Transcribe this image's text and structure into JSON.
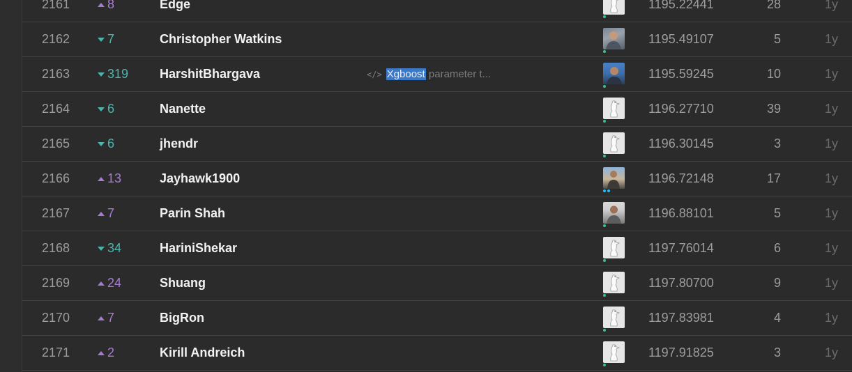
{
  "colors": {
    "background": "#2b2b2b",
    "rank_up": "#a77bd1",
    "rank_down": "#4db6ac",
    "highlight": "#3b78c8",
    "row_divider": "#444444"
  },
  "rows": [
    {
      "rank": "2161",
      "delta_dir": "up",
      "delta": "8",
      "team": "Edge",
      "kernel": null,
      "avatar": "goose",
      "score": "1195.22441",
      "entries": "28",
      "last": "1y"
    },
    {
      "rank": "2162",
      "delta_dir": "down",
      "delta": "7",
      "team": "Christopher Watkins",
      "kernel": null,
      "avatar": "photo",
      "score": "1195.49107",
      "entries": "5",
      "last": "1y"
    },
    {
      "rank": "2163",
      "delta_dir": "down",
      "delta": "319",
      "team": "HarshitBhargava",
      "kernel": {
        "icon": "code-icon",
        "highlight": "Xgboost",
        "rest": " parameter t..."
      },
      "avatar": "photo",
      "score": "1195.59245",
      "entries": "10",
      "last": "1y"
    },
    {
      "rank": "2164",
      "delta_dir": "down",
      "delta": "6",
      "team": "Nanette",
      "kernel": null,
      "avatar": "goose",
      "score": "1196.27710",
      "entries": "39",
      "last": "1y"
    },
    {
      "rank": "2165",
      "delta_dir": "down",
      "delta": "6",
      "team": "jhendr",
      "kernel": null,
      "avatar": "goose",
      "score": "1196.30145",
      "entries": "3",
      "last": "1y"
    },
    {
      "rank": "2166",
      "delta_dir": "up",
      "delta": "13",
      "team": "Jayhawk1900",
      "kernel": null,
      "avatar": "photo",
      "score": "1196.72148",
      "entries": "17",
      "last": "1y"
    },
    {
      "rank": "2167",
      "delta_dir": "up",
      "delta": "7",
      "team": "Parin Shah",
      "kernel": null,
      "avatar": "photo",
      "score": "1196.88101",
      "entries": "5",
      "last": "1y"
    },
    {
      "rank": "2168",
      "delta_dir": "down",
      "delta": "34",
      "team": "HariniShekar",
      "kernel": null,
      "avatar": "goose",
      "score": "1197.76014",
      "entries": "6",
      "last": "1y"
    },
    {
      "rank": "2169",
      "delta_dir": "up",
      "delta": "24",
      "team": "Shuang",
      "kernel": null,
      "avatar": "goose",
      "score": "1197.80700",
      "entries": "9",
      "last": "1y"
    },
    {
      "rank": "2170",
      "delta_dir": "up",
      "delta": "7",
      "team": "BigRon",
      "kernel": null,
      "avatar": "goose",
      "score": "1197.83981",
      "entries": "4",
      "last": "1y"
    },
    {
      "rank": "2171",
      "delta_dir": "up",
      "delta": "2",
      "team": "Kirill Andreich",
      "kernel": null,
      "avatar": "goose",
      "score": "1197.91825",
      "entries": "3",
      "last": "1y"
    }
  ]
}
